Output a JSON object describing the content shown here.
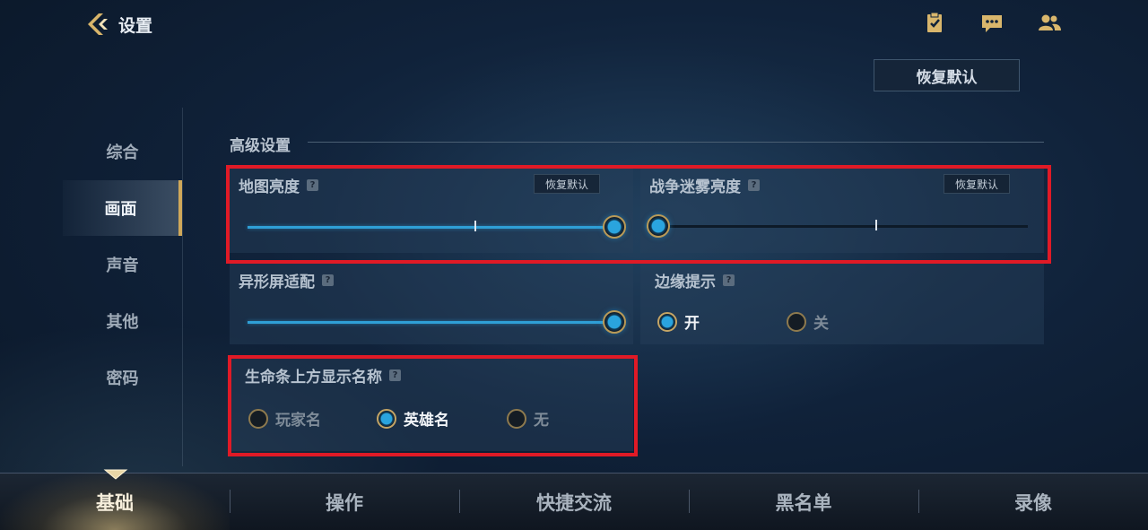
{
  "header": {
    "title": "设置",
    "restore_all": "恢复默认"
  },
  "top_icons": [
    "task-icon",
    "chat-icon",
    "friends-icon"
  ],
  "sidebar": {
    "items": [
      {
        "label": "综合",
        "active": false
      },
      {
        "label": "画面",
        "active": true
      },
      {
        "label": "声音",
        "active": false
      },
      {
        "label": "其他",
        "active": false
      },
      {
        "label": "密码",
        "active": false
      }
    ]
  },
  "section": {
    "title": "高级设置",
    "map_brightness": {
      "label": "地图亮度",
      "reset": "恢复默认",
      "value": 1.0,
      "default": 0.6
    },
    "fog_brightness": {
      "label": "战争迷雾亮度",
      "reset": "恢复默认",
      "value": 0.0,
      "default": 0.6
    },
    "notch_adapt": {
      "label": "异形屏适配",
      "value": 1.0
    },
    "edge_hint": {
      "label": "边缘提示",
      "options": [
        "开",
        "关"
      ],
      "selected": "开"
    },
    "name_above_hp": {
      "label": "生命条上方显示名称",
      "options": [
        "玩家名",
        "英雄名",
        "无"
      ],
      "selected": "英雄名"
    }
  },
  "tabs": [
    {
      "label": "基础",
      "active": true
    },
    {
      "label": "操作",
      "active": false
    },
    {
      "label": "快捷交流",
      "active": false
    },
    {
      "label": "黑名单",
      "active": false
    },
    {
      "label": "录像",
      "active": false
    }
  ],
  "colors": {
    "accent_blue": "#2f9fd6",
    "gold": "#cfa85a",
    "highlight_red": "#e01a26"
  }
}
